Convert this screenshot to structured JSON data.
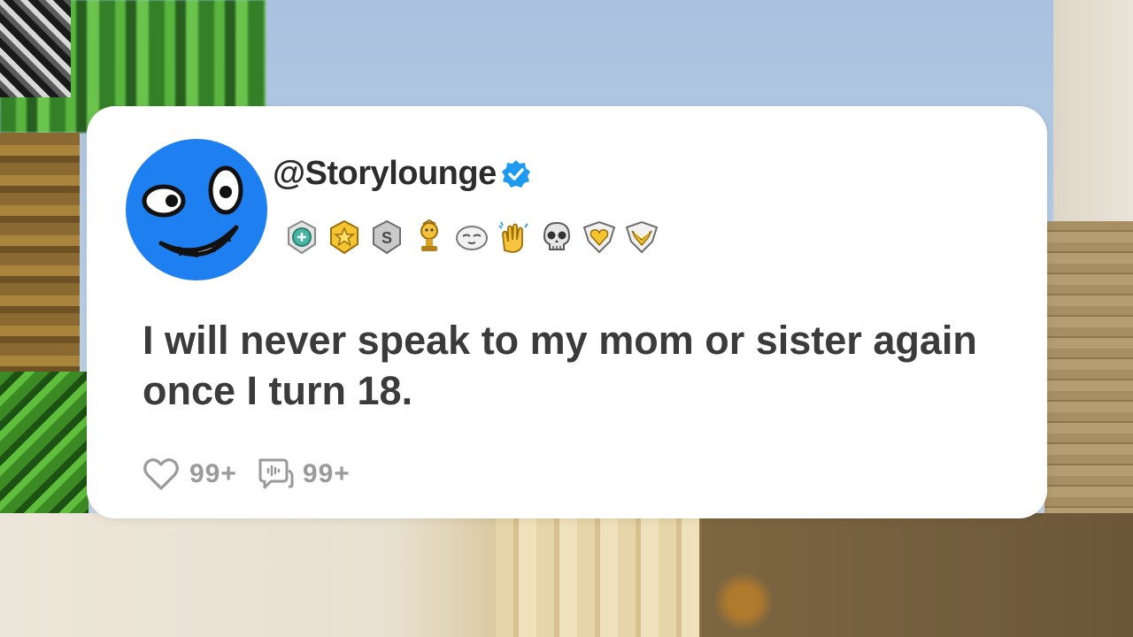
{
  "post": {
    "username": "@Storylounge",
    "verified": true,
    "text": "I will never speak to my mom or sister again once I turn 18.",
    "likes": "99+",
    "comments": "99+"
  },
  "badges": [
    "helpful-award-icon",
    "star-medal-icon",
    "silver-s-award-icon",
    "trophy-award-icon",
    "sleepy-face-award-icon",
    "clapping-hands-icon",
    "skull-icon",
    "gold-heart-shield-icon",
    "gold-wings-shield-icon"
  ],
  "colors": {
    "avatar_bg": "#1e7ff0",
    "verified": "#1d9bf0",
    "text": "#3b3b3b",
    "muted": "#9a9a9a"
  }
}
